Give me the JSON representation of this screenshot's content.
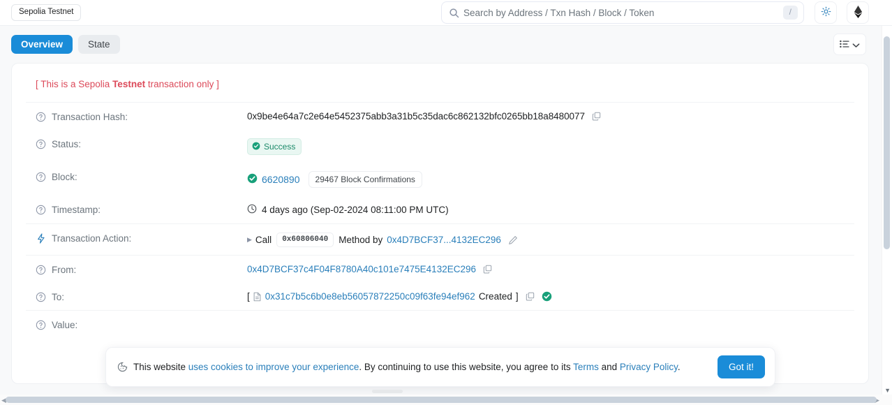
{
  "topbar": {
    "network_badge": "Sepolia Testnet",
    "search": {
      "placeholder": "Search by Address / Txn Hash / Block / Token",
      "value": "",
      "shortcut_key": "/"
    },
    "theme_toggle": "sun-icon",
    "chain_logo": "ethereum-icon"
  },
  "tabs": [
    {
      "label": "Overview",
      "active": true
    },
    {
      "label": "State",
      "active": false
    }
  ],
  "toolbar": {
    "more_button_icon": "list-icon",
    "more_button_chevron": "chevron-down-icon"
  },
  "notice": {
    "prefix": "[ This is a Sepolia ",
    "bold": "Testnet",
    "suffix": " transaction only ]"
  },
  "details": {
    "transaction_hash": {
      "label": "Transaction Hash:",
      "value": "0x9be4e64a7c2e64e5452375abb3a31b5c35dac6c862132bfc0265bb18a8480077"
    },
    "status": {
      "label": "Status:",
      "value": "Success"
    },
    "block": {
      "label": "Block:",
      "number": "6620890",
      "confirmations": "29467 Block Confirmations"
    },
    "timestamp": {
      "label": "Timestamp:",
      "value": "4 days ago (Sep-02-2024 08:11:00 PM UTC)"
    },
    "transaction_action": {
      "label": "Transaction Action:",
      "call_word": "Call",
      "method_code": "0x60806040",
      "method_by_word": "Method by",
      "method_address": "0x4D7BCF37...4132EC296"
    },
    "from": {
      "label": "From:",
      "value": "0x4D7BCF37c4F04F8780A40c101e7475E4132EC296"
    },
    "to": {
      "label": "To:",
      "open_bracket": "[",
      "address": "0x31c7b5c6b0e8eb56057872250c09f63fe94ef962",
      "created_word": "Created",
      "close_bracket": "]"
    },
    "value": {
      "label": "Value:"
    }
  },
  "cookie_banner": {
    "lead": "This website ",
    "link1": "uses cookies to improve your experience",
    "mid": ". By continuing to use this website, you agree to its ",
    "link2": "Terms",
    "and": " and ",
    "link3": "Privacy Policy",
    "period": ".",
    "button": "Got it!"
  },
  "colors": {
    "accent_blue": "#1a8cd8",
    "link_blue": "#2a7fba",
    "success_green": "#1c8a6a",
    "testnet_red": "#dc4a5a",
    "page_bg": "#f8f9fa"
  }
}
